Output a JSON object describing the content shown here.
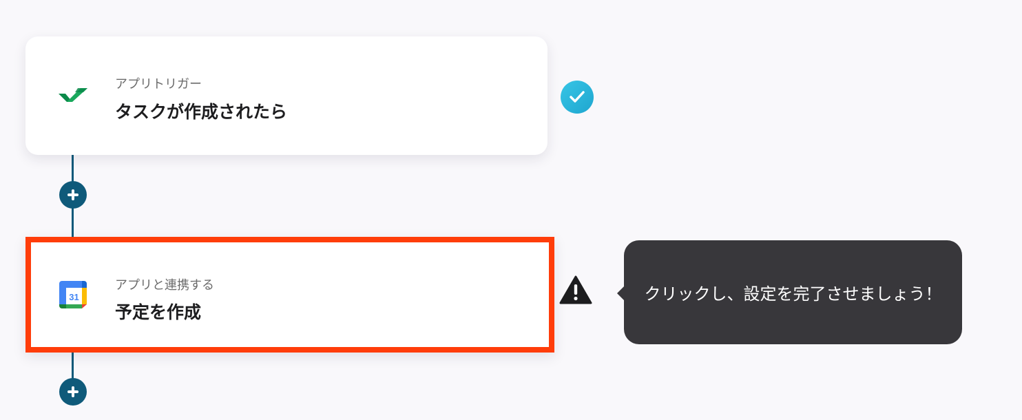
{
  "flow": {
    "step1": {
      "app_icon": "wrike-check-icon",
      "subtitle": "アプリトリガー",
      "title": "タスクが作成されたら",
      "status": "completed"
    },
    "step2": {
      "app_icon": "google-calendar-icon",
      "calendar_number": "31",
      "subtitle": "アプリと連携する",
      "title": "予定を作成",
      "status": "warning"
    }
  },
  "tooltip": {
    "text": "クリックし、設定を完了させましょう！"
  },
  "colors": {
    "connector": "#0f5a7a",
    "highlight_border": "#ff3d0a",
    "check_badge": "#29b7dc",
    "tooltip_bg": "#38373b"
  }
}
